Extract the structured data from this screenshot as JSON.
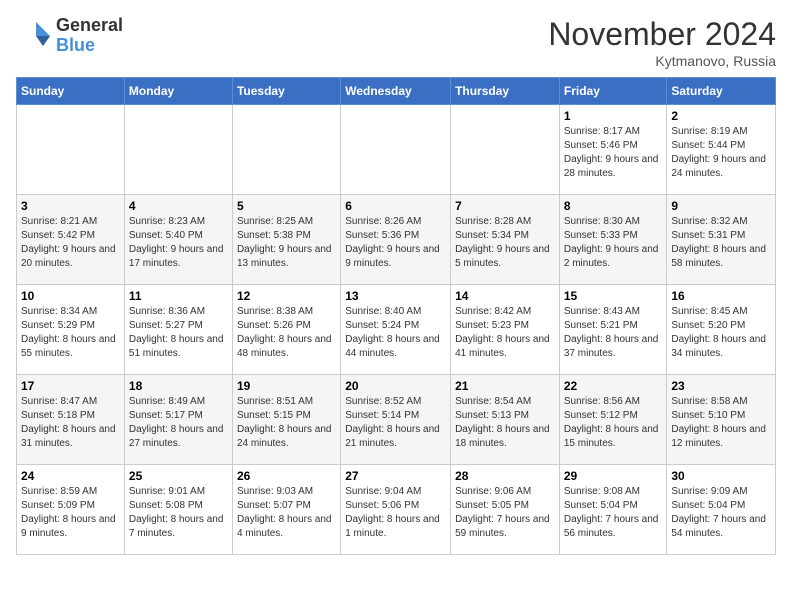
{
  "logo": {
    "line1": "General",
    "line2": "Blue"
  },
  "title": "November 2024",
  "subtitle": "Kytmanovo, Russia",
  "days_of_week": [
    "Sunday",
    "Monday",
    "Tuesday",
    "Wednesday",
    "Thursday",
    "Friday",
    "Saturday"
  ],
  "weeks": [
    [
      {
        "day": "",
        "info": ""
      },
      {
        "day": "",
        "info": ""
      },
      {
        "day": "",
        "info": ""
      },
      {
        "day": "",
        "info": ""
      },
      {
        "day": "",
        "info": ""
      },
      {
        "day": "1",
        "info": "Sunrise: 8:17 AM\nSunset: 5:46 PM\nDaylight: 9 hours and 28 minutes."
      },
      {
        "day": "2",
        "info": "Sunrise: 8:19 AM\nSunset: 5:44 PM\nDaylight: 9 hours and 24 minutes."
      }
    ],
    [
      {
        "day": "3",
        "info": "Sunrise: 8:21 AM\nSunset: 5:42 PM\nDaylight: 9 hours and 20 minutes."
      },
      {
        "day": "4",
        "info": "Sunrise: 8:23 AM\nSunset: 5:40 PM\nDaylight: 9 hours and 17 minutes."
      },
      {
        "day": "5",
        "info": "Sunrise: 8:25 AM\nSunset: 5:38 PM\nDaylight: 9 hours and 13 minutes."
      },
      {
        "day": "6",
        "info": "Sunrise: 8:26 AM\nSunset: 5:36 PM\nDaylight: 9 hours and 9 minutes."
      },
      {
        "day": "7",
        "info": "Sunrise: 8:28 AM\nSunset: 5:34 PM\nDaylight: 9 hours and 5 minutes."
      },
      {
        "day": "8",
        "info": "Sunrise: 8:30 AM\nSunset: 5:33 PM\nDaylight: 9 hours and 2 minutes."
      },
      {
        "day": "9",
        "info": "Sunrise: 8:32 AM\nSunset: 5:31 PM\nDaylight: 8 hours and 58 minutes."
      }
    ],
    [
      {
        "day": "10",
        "info": "Sunrise: 8:34 AM\nSunset: 5:29 PM\nDaylight: 8 hours and 55 minutes."
      },
      {
        "day": "11",
        "info": "Sunrise: 8:36 AM\nSunset: 5:27 PM\nDaylight: 8 hours and 51 minutes."
      },
      {
        "day": "12",
        "info": "Sunrise: 8:38 AM\nSunset: 5:26 PM\nDaylight: 8 hours and 48 minutes."
      },
      {
        "day": "13",
        "info": "Sunrise: 8:40 AM\nSunset: 5:24 PM\nDaylight: 8 hours and 44 minutes."
      },
      {
        "day": "14",
        "info": "Sunrise: 8:42 AM\nSunset: 5:23 PM\nDaylight: 8 hours and 41 minutes."
      },
      {
        "day": "15",
        "info": "Sunrise: 8:43 AM\nSunset: 5:21 PM\nDaylight: 8 hours and 37 minutes."
      },
      {
        "day": "16",
        "info": "Sunrise: 8:45 AM\nSunset: 5:20 PM\nDaylight: 8 hours and 34 minutes."
      }
    ],
    [
      {
        "day": "17",
        "info": "Sunrise: 8:47 AM\nSunset: 5:18 PM\nDaylight: 8 hours and 31 minutes."
      },
      {
        "day": "18",
        "info": "Sunrise: 8:49 AM\nSunset: 5:17 PM\nDaylight: 8 hours and 27 minutes."
      },
      {
        "day": "19",
        "info": "Sunrise: 8:51 AM\nSunset: 5:15 PM\nDaylight: 8 hours and 24 minutes."
      },
      {
        "day": "20",
        "info": "Sunrise: 8:52 AM\nSunset: 5:14 PM\nDaylight: 8 hours and 21 minutes."
      },
      {
        "day": "21",
        "info": "Sunrise: 8:54 AM\nSunset: 5:13 PM\nDaylight: 8 hours and 18 minutes."
      },
      {
        "day": "22",
        "info": "Sunrise: 8:56 AM\nSunset: 5:12 PM\nDaylight: 8 hours and 15 minutes."
      },
      {
        "day": "23",
        "info": "Sunrise: 8:58 AM\nSunset: 5:10 PM\nDaylight: 8 hours and 12 minutes."
      }
    ],
    [
      {
        "day": "24",
        "info": "Sunrise: 8:59 AM\nSunset: 5:09 PM\nDaylight: 8 hours and 9 minutes."
      },
      {
        "day": "25",
        "info": "Sunrise: 9:01 AM\nSunset: 5:08 PM\nDaylight: 8 hours and 7 minutes."
      },
      {
        "day": "26",
        "info": "Sunrise: 9:03 AM\nSunset: 5:07 PM\nDaylight: 8 hours and 4 minutes."
      },
      {
        "day": "27",
        "info": "Sunrise: 9:04 AM\nSunset: 5:06 PM\nDaylight: 8 hours and 1 minute."
      },
      {
        "day": "28",
        "info": "Sunrise: 9:06 AM\nSunset: 5:05 PM\nDaylight: 7 hours and 59 minutes."
      },
      {
        "day": "29",
        "info": "Sunrise: 9:08 AM\nSunset: 5:04 PM\nDaylight: 7 hours and 56 minutes."
      },
      {
        "day": "30",
        "info": "Sunrise: 9:09 AM\nSunset: 5:04 PM\nDaylight: 7 hours and 54 minutes."
      }
    ]
  ]
}
